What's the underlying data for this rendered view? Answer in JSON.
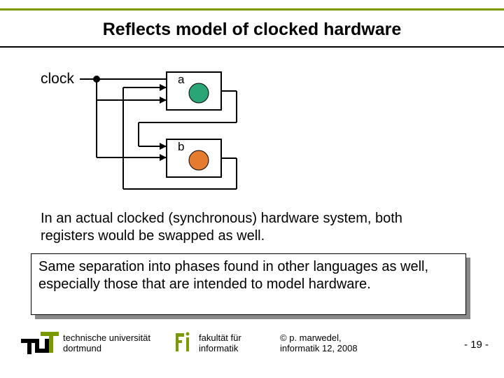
{
  "title": "Reflects model of clocked hardware",
  "diagram": {
    "clock_label": "clock",
    "register_a": "a",
    "register_b": "b"
  },
  "body_text": "In an actual clocked (synchronous) hardware system, both registers would be swapped as well.",
  "callout_text": "Same separation into phases found in other languages as well, especially those that are intended to model hardware.",
  "footer": {
    "university_line1": "technische universität",
    "university_line2": "dortmund",
    "faculty_line1": "fakultät für",
    "faculty_line2": "informatik",
    "copyright_line1": "©  p. marwedel,",
    "copyright_line2": "informatik 12,  2008",
    "page_number": "-  19 -"
  },
  "colors": {
    "accent": "#7a9a01",
    "register_a_fill": "#2aa676",
    "register_b_fill": "#e47b2f"
  }
}
